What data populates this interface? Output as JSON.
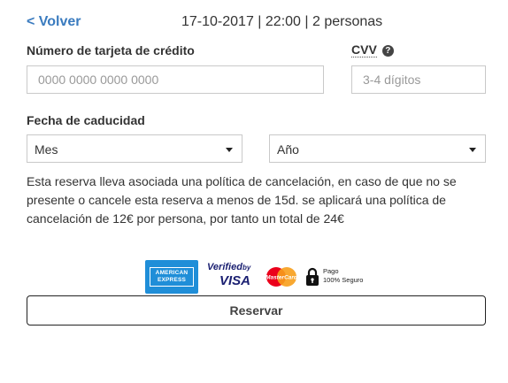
{
  "header": {
    "back_label": "< Volver",
    "booking_info": "17-10-2017 | 22:00 | 2 personas"
  },
  "form": {
    "card_number_label": "Número de tarjeta de crédito",
    "card_number_placeholder": "0000 0000 0000 0000",
    "cvv_label": "CVV",
    "cvv_placeholder": "3-4 dígitos",
    "expiry_label": "Fecha de caducidad",
    "month_value": "Mes",
    "year_value": "Año"
  },
  "policy_text": "Esta reserva lleva asociada una política de cancelación, en caso de que no se presente o cancele esta reserva a menos de 15d. se aplicará una política de cancelación de 12€ por persona, por tanto un total de 24€",
  "logos": {
    "amex_line1": "AMERICAN",
    "amex_line2": "EXPRESS",
    "vbv_verified": "Verified",
    "vbv_by": "by",
    "vbv_visa": "VISA",
    "mastercard_text": "MasterCard",
    "secure_line1": "Pago",
    "secure_line2": "100% Seguro"
  },
  "colors": {
    "link": "#3a7bbf",
    "amex_blue": "#1f8ed8",
    "visa_navy": "#1a1f71",
    "mastercard_red": "#eb001b",
    "mastercard_orange": "#f79e1b"
  },
  "icons": {
    "help": "question-circle-icon",
    "dropdown": "chevron-down-icon",
    "lock": "lock-icon"
  },
  "reserve_button_label": "Reservar"
}
